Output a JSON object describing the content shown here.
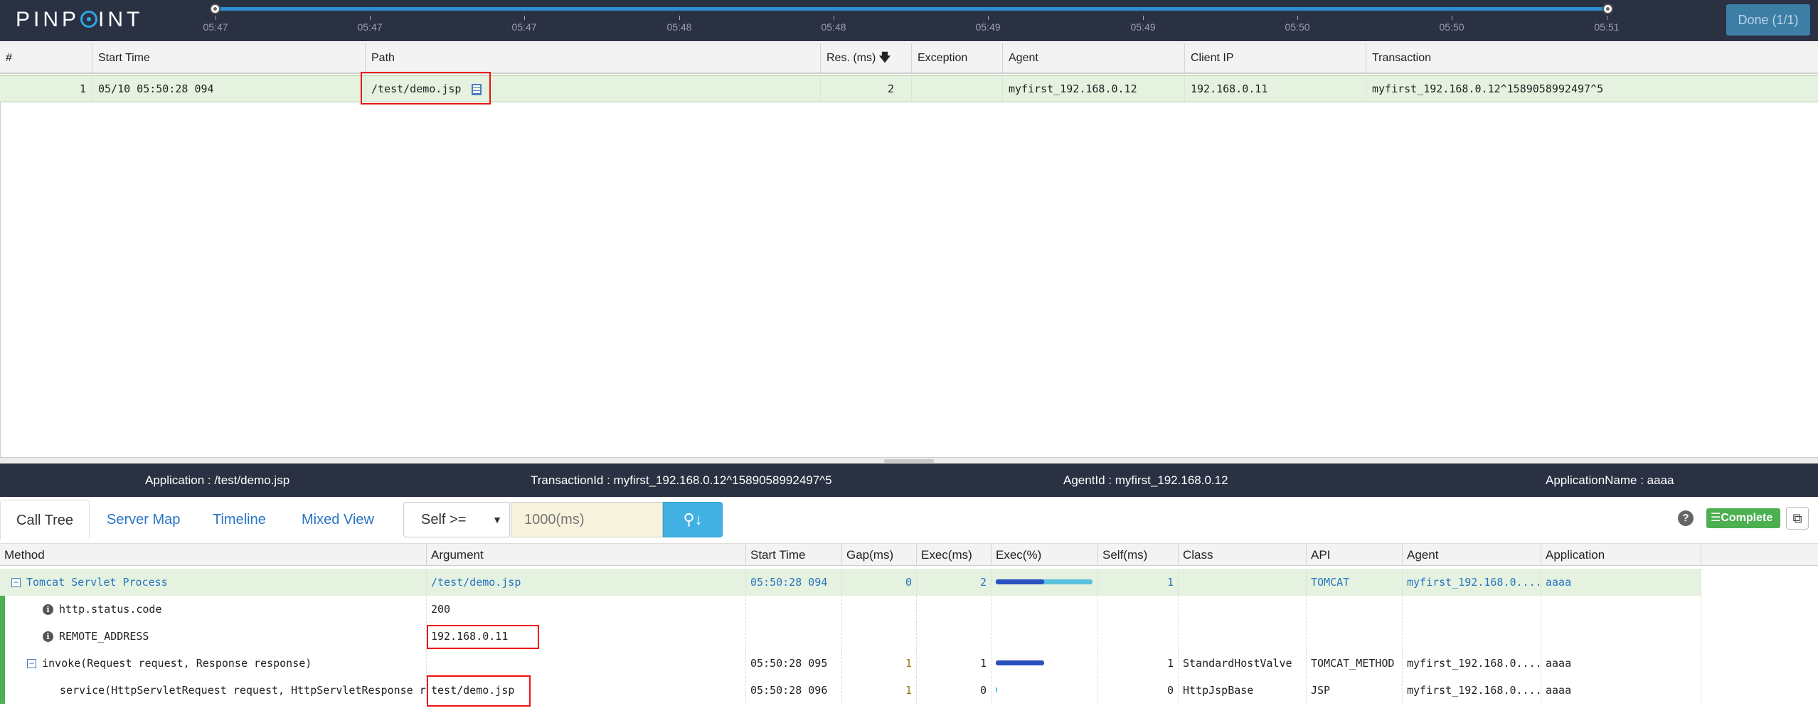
{
  "app": {
    "logo": "PINPOINT",
    "done_button": "Done (1/1)"
  },
  "timeline": {
    "ticks": [
      "05:47",
      "05:47",
      "05:47",
      "05:48",
      "05:48",
      "05:49",
      "05:49",
      "05:50",
      "05:50",
      "05:51"
    ]
  },
  "grid": {
    "columns": [
      "#",
      "Start Time",
      "Path",
      "Res. (ms)",
      "Exception",
      "Agent",
      "Client IP",
      "Transaction"
    ],
    "rows": [
      {
        "num": "1",
        "start_time": "05/10 05:50:28 094",
        "path": "/test/demo.jsp",
        "res": "2",
        "exception": "",
        "agent": "myfirst_192.168.0.12",
        "client_ip": "192.168.0.11",
        "transaction": "myfirst_192.168.0.12^1589058992497^5"
      }
    ]
  },
  "info_bar": {
    "application": "Application : /test/demo.jsp",
    "transaction_id": "TransactionId : myfirst_192.168.0.12^1589058992497^5",
    "agent_id": "AgentId : myfirst_192.168.0.12",
    "application_name": "ApplicationName : aaaa"
  },
  "tabs": [
    "Call Tree",
    "Server Map",
    "Timeline",
    "Mixed View"
  ],
  "filter": {
    "select_value": "Self >=",
    "input_placeholder": "1000(ms)"
  },
  "status": {
    "complete": "Complete",
    "help": "?"
  },
  "call_tree": {
    "columns": [
      "Method",
      "Argument",
      "Start Time",
      "Gap(ms)",
      "Exec(ms)",
      "Exec(%)",
      "Self(ms)",
      "Class",
      "API",
      "Agent",
      "Application"
    ],
    "rows": [
      {
        "method": "Tomcat Servlet Process",
        "argument": "/test/demo.jsp",
        "start_time": "05:50:28 094",
        "gap": "0",
        "exec": "2",
        "exec_pct": 100,
        "self_pct": 50,
        "self": "1",
        "class": "",
        "api": "TOMCAT",
        "agent": "myfirst_192.168.0....",
        "application": "aaaa"
      },
      {
        "method": "http.status.code",
        "argument": "200",
        "start_time": "",
        "gap": "",
        "exec": "",
        "self": "",
        "class": "",
        "api": "",
        "agent": "",
        "application": ""
      },
      {
        "method": "REMOTE_ADDRESS",
        "argument": "192.168.0.11",
        "start_time": "",
        "gap": "",
        "exec": "",
        "self": "",
        "class": "",
        "api": "",
        "agent": "",
        "application": ""
      },
      {
        "method": "invoke(Request request, Response response)",
        "argument": "",
        "start_time": "05:50:28 095",
        "gap": "1",
        "exec": "1",
        "exec_pct": 50,
        "self": "1",
        "class": "StandardHostValve",
        "api": "TOMCAT_METHOD",
        "agent": "myfirst_192.168.0....",
        "application": "aaaa"
      },
      {
        "method": "service(HttpServletRequest request, HttpServletResponse r",
        "argument": "test/demo.jsp",
        "start_time": "05:50:28 096",
        "gap": "1",
        "exec": "0",
        "exec_pct": 1,
        "self": "0",
        "class": "HttpJspBase",
        "api": "JSP",
        "agent": "myfirst_192.168.0....",
        "application": "aaaa"
      }
    ]
  },
  "colors": {
    "header_bg": "#2a3142",
    "accent": "#2b8fd4",
    "selected_row": "#e4f2df",
    "highlight_box": "#ee1111",
    "complete": "#4caf50"
  }
}
